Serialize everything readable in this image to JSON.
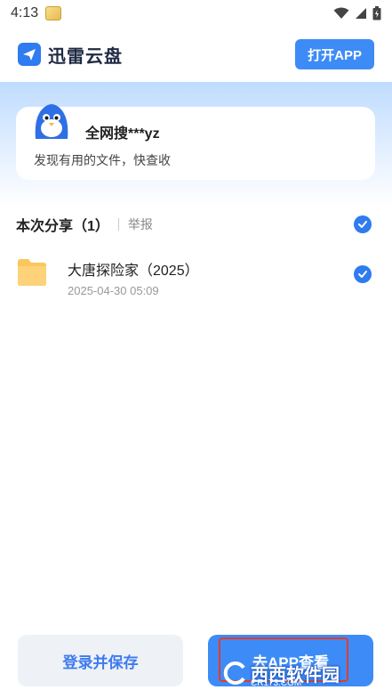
{
  "status_bar": {
    "time": "4:13"
  },
  "header": {
    "app_name": "迅雷云盘",
    "open_app_label": "打开APP"
  },
  "share_card": {
    "sharer_name": "全网搜***yz",
    "description": "发现有用的文件，快查收"
  },
  "section": {
    "title": "本次分享（1）",
    "report_label": "举报"
  },
  "files": [
    {
      "name": "大唐探险家（2025）",
      "date": "2025-04-30 05:09"
    }
  ],
  "bottom": {
    "login_save_label": "登录并保存",
    "open_in_app_label": "去APP查看"
  },
  "watermark": {
    "text": "西西软件园",
    "sub": "CR173.COM"
  },
  "colors": {
    "accent": "#3d8bf6",
    "folder": "#fbc75a",
    "highlight": "#e23c2a"
  }
}
